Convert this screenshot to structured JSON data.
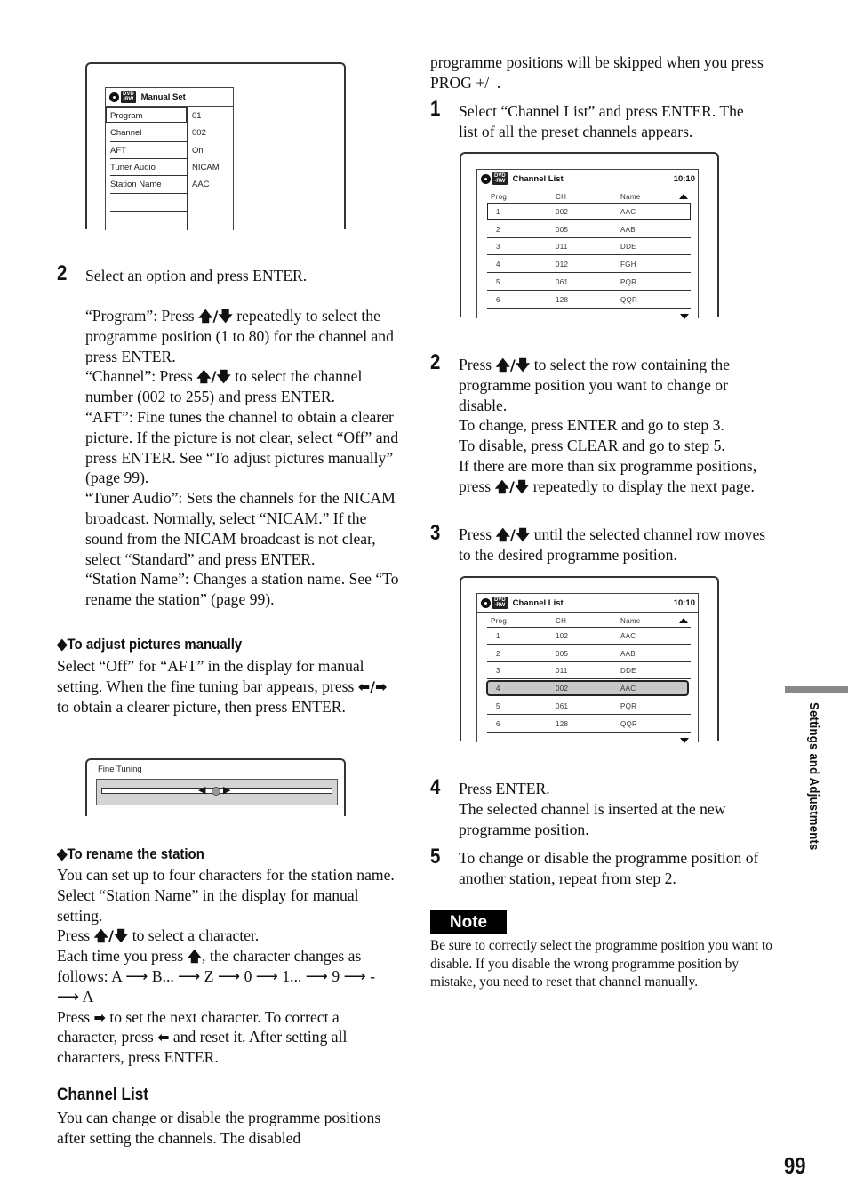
{
  "page": {
    "number": "99",
    "section_tab": "Settings and Adjustments"
  },
  "manual_set_screen": {
    "title": "Manual Set",
    "disc_badge": "DVD -RW",
    "rows": [
      {
        "label": "Program",
        "value": "01"
      },
      {
        "label": "Channel",
        "value": "002"
      },
      {
        "label": "AFT",
        "value": "On"
      },
      {
        "label": "Tuner Audio",
        "value": "NICAM"
      },
      {
        "label": "Station Name",
        "value": "AAC"
      }
    ]
  },
  "left_column": {
    "step2": {
      "number": "2",
      "title": "Select an option and press ENTER.",
      "program_a": "“Program”: Press ",
      "program_b": " repeatedly to select the programme position (1 to 80) for the channel and press ENTER.",
      "channel_a": "“Channel”: Press ",
      "channel_b": " to select the channel number (002 to 255) and press ENTER.",
      "aft": "“AFT”: Fine tunes the channel to obtain a clearer picture. If the picture is not clear, select “Off” and press ENTER. See “To adjust pictures manually” (page 99).",
      "tuner_audio": "“Tuner Audio”: Sets the channels for the NICAM broadcast. Normally, select “NICAM.” If the sound from the NICAM broadcast is not clear, select “Standard” and press ENTER.",
      "station_name": "“Station Name”: Changes a station name. See “To rename the station” (page 99)."
    },
    "adjust_pictures": {
      "heading": "◆To adjust pictures manually",
      "text_a": "Select “Off” for “AFT” in the display for manual setting. When the fine tuning bar appears, press ",
      "text_b": " to obtain a clearer picture, then press ENTER."
    },
    "fine_tuning_screen": {
      "title": "Fine Tuning",
      "level": 0.5
    },
    "rename_station": {
      "heading": "◆To rename the station",
      "p1": "You can set up to four characters for the station name. Select “Station Name” in the display for manual setting.",
      "p2_a": "Press ",
      "p2_b": " to select a character.",
      "p3_a": "Each time you press ",
      "p3_b": ", the character changes as follows: A ⟶ B... ⟶ Z ⟶ 0 ⟶ 1... ⟶ 9 ⟶ - ⟶ A",
      "p4_a": "Press ",
      "p4_b": " to set the next character. To correct a character, press ",
      "p4_c": " and reset it. After setting all characters, press ENTER."
    },
    "channel_list": {
      "heading": "Channel List",
      "text": "You can change or disable the programme positions after setting the channels. The disabled"
    }
  },
  "right_column": {
    "continued": "programme positions will be skipped when you press PROG +/–.",
    "step1": {
      "number": "1",
      "text": "Select “Channel List” and press ENTER. The list of all the preset channels appears."
    },
    "channel_list_screen_1": {
      "title": "Channel List",
      "disc_badge": "DVD -RW",
      "time": "10:10",
      "columns": [
        "Prog.",
        "CH",
        "Name"
      ],
      "rows": [
        {
          "prog": "1",
          "ch": "002",
          "name": "AAC"
        },
        {
          "prog": "2",
          "ch": "005",
          "name": "AAB"
        },
        {
          "prog": "3",
          "ch": "011",
          "name": "DDE"
        },
        {
          "prog": "4",
          "ch": "012",
          "name": "FGH"
        },
        {
          "prog": "5",
          "ch": "061",
          "name": "PQR"
        },
        {
          "prog": "6",
          "ch": "128",
          "name": "QQR"
        }
      ],
      "selected_row": 1
    },
    "step2": {
      "number": "2",
      "text_a": "Press ",
      "text_b": " to select the row containing the programme position you want to change or disable.",
      "line2": "To change, press ENTER and go to step 3.",
      "line3": "To disable, press CLEAR and go to step 5.",
      "line4_a": "If there are more than six programme positions, press ",
      "line4_b": " repeatedly to display the next page."
    },
    "step3": {
      "number": "3",
      "text_a": "Press ",
      "text_b": " until the selected channel row moves to the desired programme position."
    },
    "channel_list_screen_2": {
      "title": "Channel List",
      "disc_badge": "DVD -RW",
      "time": "10:10",
      "columns": [
        "Prog.",
        "CH",
        "Name"
      ],
      "rows": [
        {
          "prog": "1",
          "ch": "102",
          "name": "AAC"
        },
        {
          "prog": "2",
          "ch": "005",
          "name": "AAB"
        },
        {
          "prog": "3",
          "ch": "011",
          "name": "DDE"
        },
        {
          "prog": "4",
          "ch": "002",
          "name": "AAC"
        },
        {
          "prog": "5",
          "ch": "061",
          "name": "PQR"
        },
        {
          "prog": "6",
          "ch": "128",
          "name": "QQR"
        }
      ],
      "selected_row": 4
    },
    "step4": {
      "number": "4",
      "text": "Press ENTER.",
      "subtext": "The selected channel is inserted at the new programme position."
    },
    "step5": {
      "number": "5",
      "text": "To change or disable the programme position of another station, repeat from step 2."
    },
    "note": {
      "label": "Note",
      "text": "Be sure to correctly select the programme position you want to disable. If you disable the wrong programme position by mistake, you need to reset that channel manually."
    }
  },
  "icons": {
    "up_down": "🡅/🡇",
    "left_right": "⬅/➡"
  }
}
